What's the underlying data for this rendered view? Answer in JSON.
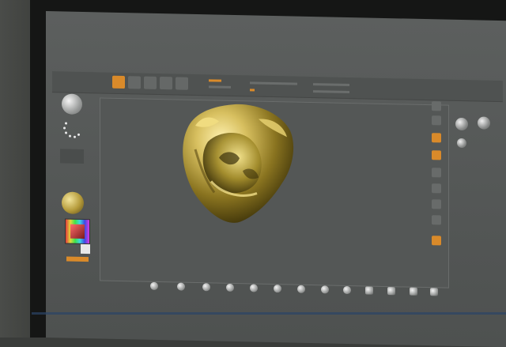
{
  "photo": {
    "subject": "projector-screen-showing-3d-sculpting-app"
  },
  "app": {
    "colors": {
      "accent": "#d98a2a",
      "ui_bg": "#565958",
      "model_gold": "#c8b040"
    },
    "icons": [
      "brush-sphere-icon",
      "material-sphere-icon",
      "color-picker-icon",
      "model-icon"
    ]
  }
}
